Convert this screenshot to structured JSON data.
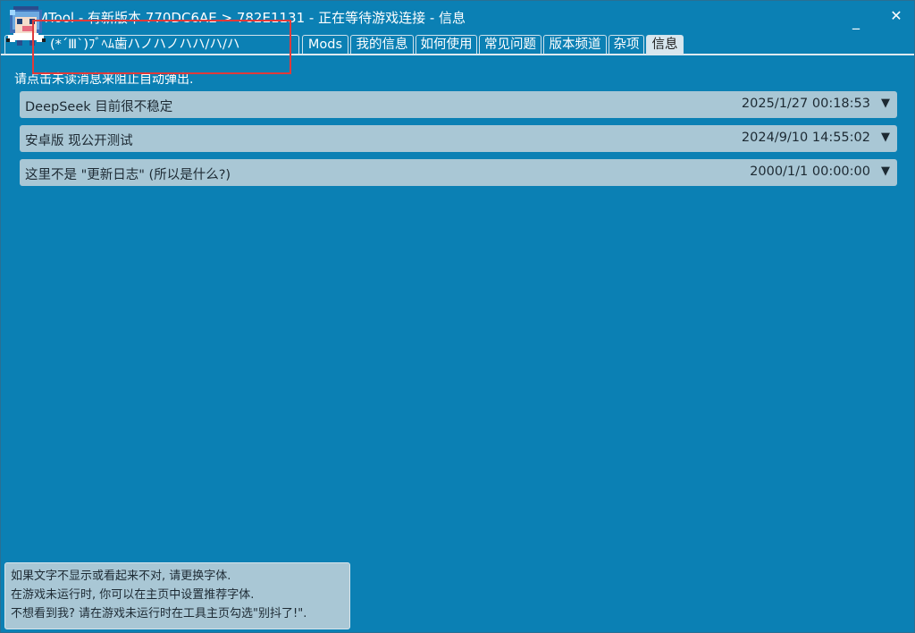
{
  "window": {
    "title": "MTool - 有新版本 770DC6AE > 782E1131 - 正在等待游戏连接 - 信息",
    "minimize_label": "_",
    "close_label": "✕"
  },
  "tabs": [
    {
      "id": "emote",
      "label": "(*´Ⅲ`)ﾌﾞﾍﾑ歯ハノハノハハ/ハ/ハ",
      "active": false
    },
    {
      "id": "mods",
      "label": "Mods",
      "active": false
    },
    {
      "id": "myinfo",
      "label": "我的信息",
      "active": false
    },
    {
      "id": "howto",
      "label": "如何使用",
      "active": false
    },
    {
      "id": "faq",
      "label": "常见问题",
      "active": false
    },
    {
      "id": "channel",
      "label": "版本频道",
      "active": false
    },
    {
      "id": "misc",
      "label": "杂项",
      "active": false
    },
    {
      "id": "info",
      "label": "信息",
      "active": true
    }
  ],
  "hint": "请点击未读消息来阻止自动弹出.",
  "messages": [
    {
      "title": "DeepSeek 目前很不稳定",
      "time": "2025/1/27 00:18:53",
      "arrow": "▼"
    },
    {
      "title": "安卓版 现公开测试",
      "time": "2024/9/10 14:55:02",
      "arrow": "▼"
    },
    {
      "title": "这里不是 \"更新日志\" (所以是什么?)",
      "time": "2000/1/1 00:00:00",
      "arrow": "▼"
    }
  ],
  "tip": {
    "line1": "如果文字不显示或看起来不对, 请更换字体.",
    "line2": "在游戏未运行时, 你可以在主页中设置推荐字体.",
    "line3": "不想看到我? 请在游戏未运行时在工具主页勾选\"别抖了!\"."
  },
  "colors": {
    "background": "#0b80b4",
    "row": "#a9c7d5",
    "highlight": "#e03a3a"
  }
}
